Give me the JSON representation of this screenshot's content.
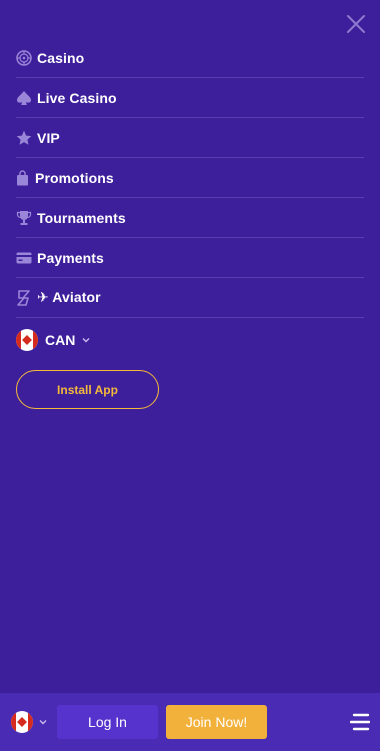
{
  "menu": {
    "items": [
      {
        "label": "Casino",
        "icon": "roulette-icon"
      },
      {
        "label": "Live Casino",
        "icon": "spade-icon"
      },
      {
        "label": "VIP",
        "icon": "star-icon"
      },
      {
        "label": "Promotions",
        "icon": "gift-bag-icon"
      },
      {
        "label": "Tournaments",
        "icon": "trophy-icon"
      },
      {
        "label": "Payments",
        "icon": "credit-card-icon"
      },
      {
        "label": "✈ Aviator",
        "icon": "aviator-icon"
      }
    ],
    "country": {
      "code": "CAN",
      "flag": "canada-flag-icon"
    },
    "install_label": "Install App"
  },
  "bottom_bar": {
    "login_label": "Log In",
    "join_label": "Join Now!"
  },
  "colors": {
    "background": "#3d1f9b",
    "bottom_bar": "#4a2bb3",
    "login_button": "#5633cc",
    "join_button": "#f2b13a",
    "install_border": "#f5b93a",
    "icon_color": "#9a86d8",
    "divider": "#5a3fb0"
  }
}
